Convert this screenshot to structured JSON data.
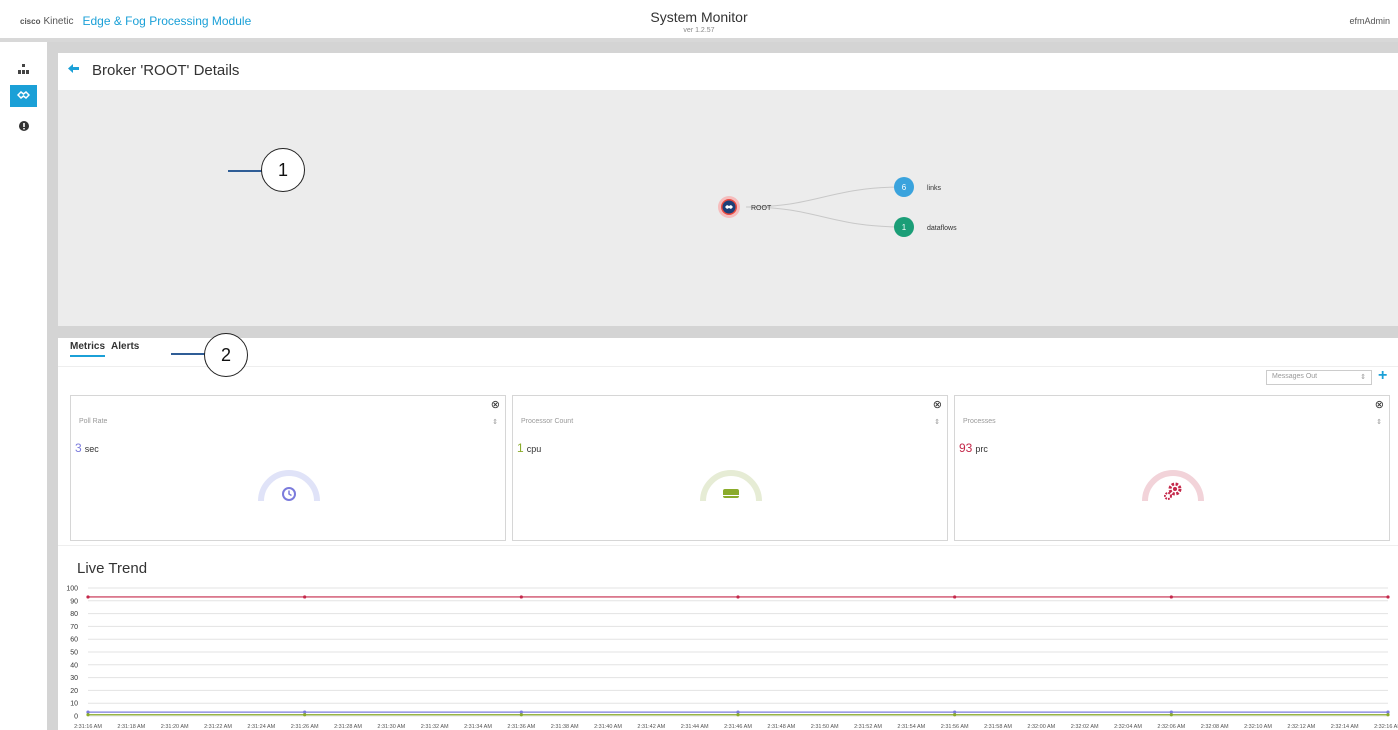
{
  "header": {
    "brand_cisco": "cisco",
    "brand_kinetic": "Kinetic",
    "module": "Edge & Fog Processing Module",
    "title": "System Monitor",
    "version": "ver 1.2.57",
    "user": "efmAdmin"
  },
  "sidebar": {
    "items": [
      {
        "name": "hierarchy-icon",
        "active": false
      },
      {
        "name": "broker-icon",
        "active": true
      },
      {
        "name": "alert-icon",
        "active": false
      }
    ]
  },
  "page": {
    "back_icon": "arrow-left-icon",
    "title": "Broker 'ROOT' Details"
  },
  "graph": {
    "root_label": "ROOT",
    "nodes": [
      {
        "count": "6",
        "label": "links",
        "color": "#3aa3dd"
      },
      {
        "count": "1",
        "label": "dataflows",
        "color": "#1b9e77"
      }
    ]
  },
  "callouts": [
    "1",
    "2"
  ],
  "tabs": [
    {
      "label": "Metrics",
      "active": true
    },
    {
      "label": "Alerts",
      "active": false
    }
  ],
  "metric_select": {
    "value": "Messages Out"
  },
  "cards": [
    {
      "title": "Poll Rate",
      "value": "3",
      "unit": "sec",
      "color": "#7b7bdc",
      "track": "#e0e3f8",
      "icon": "clock-icon"
    },
    {
      "title": "Processor Count",
      "value": "1",
      "unit": "cpu",
      "color": "#8aab2a",
      "track": "#e6ecd5",
      "icon": "cpu-icon"
    },
    {
      "title": "Processes",
      "value": "93",
      "unit": "prc",
      "color": "#c4284a",
      "track": "#f2d3d9",
      "icon": "gears-icon"
    }
  ],
  "trend": {
    "title": "Live Trend"
  },
  "chart_data": {
    "type": "line",
    "title": "Live Trend",
    "ylim": [
      0,
      100
    ],
    "yticks": [
      0,
      10,
      20,
      30,
      40,
      50,
      60,
      70,
      80,
      90,
      100
    ],
    "grid": true,
    "categories": [
      "2:31:16 AM",
      "2:31:18 AM",
      "2:31:20 AM",
      "2:31:22 AM",
      "2:31:24 AM",
      "2:31:26 AM",
      "2:31:28 AM",
      "2:31:30 AM",
      "2:31:32 AM",
      "2:31:34 AM",
      "2:31:36 AM",
      "2:31:38 AM",
      "2:31:40 AM",
      "2:31:42 AM",
      "2:31:44 AM",
      "2:31:46 AM",
      "2:31:48 AM",
      "2:31:50 AM",
      "2:31:52 AM",
      "2:31:54 AM",
      "2:31:56 AM",
      "2:31:58 AM",
      "2:32:00 AM",
      "2:32:02 AM",
      "2:32:04 AM",
      "2:32:06 AM",
      "2:32:08 AM",
      "2:32:10 AM",
      "2:32:12 AM",
      "2:32:14 AM",
      "2:32:16 AM"
    ],
    "series": [
      {
        "values": [
          93,
          93,
          93,
          93,
          93,
          93,
          93,
          93,
          93,
          93,
          93,
          93,
          93,
          93,
          93,
          93,
          93,
          93,
          93,
          93,
          93,
          93,
          93,
          93,
          93,
          93,
          93,
          93,
          93,
          93,
          93
        ],
        "color": "#c4284a"
      },
      {
        "values": [
          3,
          3,
          3,
          3,
          3,
          3,
          3,
          3,
          3,
          3,
          3,
          3,
          3,
          3,
          3,
          3,
          3,
          3,
          3,
          3,
          3,
          3,
          3,
          3,
          3,
          3,
          3,
          3,
          3,
          3,
          3
        ],
        "color": "#7b7bdc"
      },
      {
        "values": [
          1,
          1,
          1,
          1,
          1,
          1,
          1,
          1,
          1,
          1,
          1,
          1,
          1,
          1,
          1,
          1,
          1,
          1,
          1,
          1,
          1,
          1,
          1,
          1,
          1,
          1,
          1,
          1,
          1,
          1,
          1
        ],
        "color": "#8aab2a"
      }
    ]
  }
}
